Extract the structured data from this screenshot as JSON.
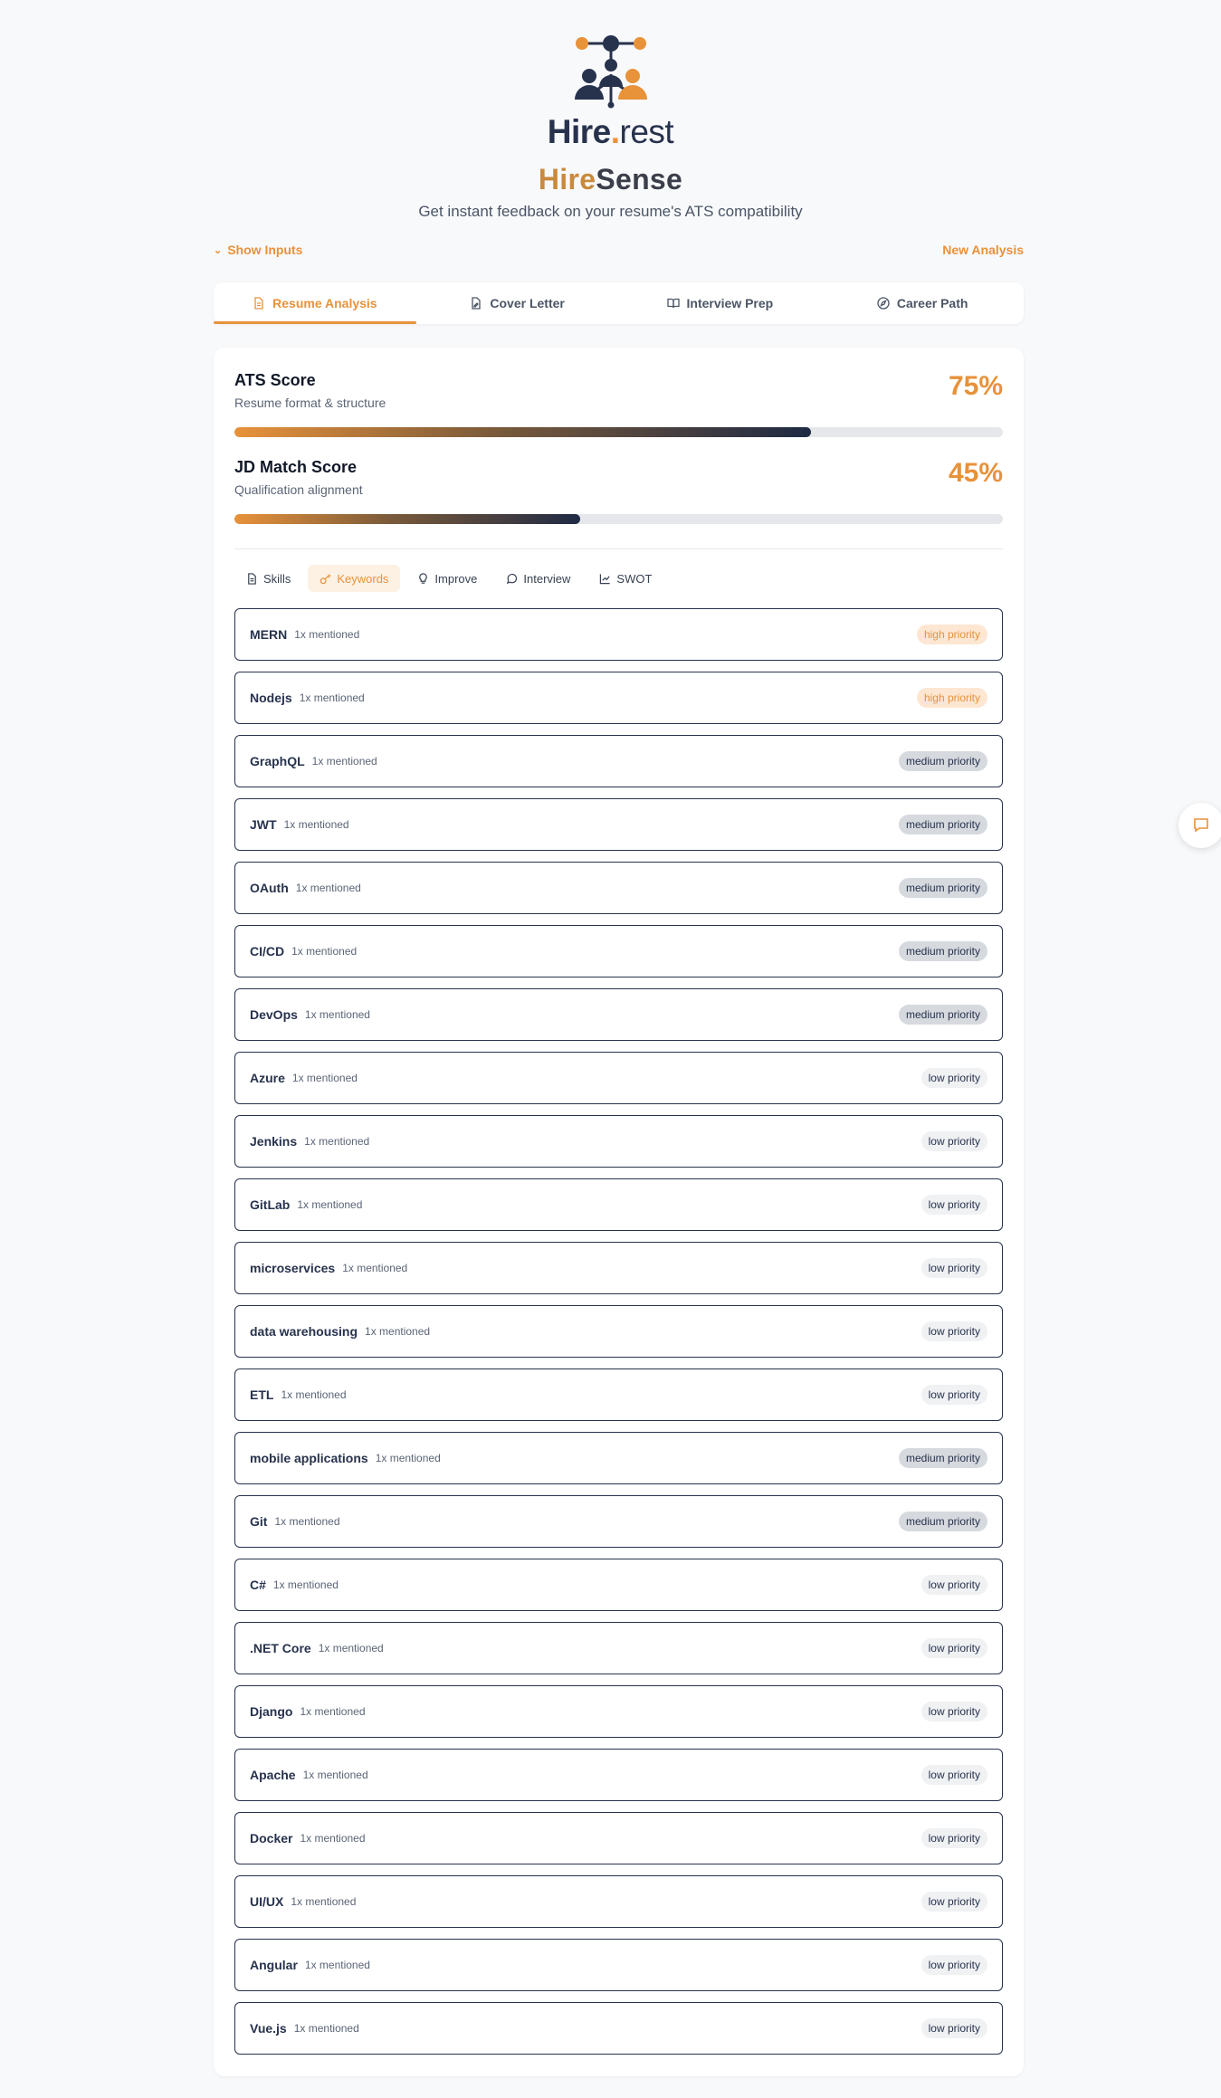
{
  "brand": {
    "logo_name": "Hire",
    "logo_dot": ".",
    "logo_suffix": "rest",
    "app_title_part1": "Hire",
    "app_title_part2": "Sense",
    "subtitle": "Get instant feedback on your resume's ATS compatibility",
    "accent": "#e8923a",
    "navy": "#27324d"
  },
  "toolbar": {
    "show_inputs": "Show Inputs",
    "new_analysis": "New Analysis"
  },
  "tabs": [
    {
      "label": "Resume Analysis",
      "icon": "file-text-icon",
      "active": true
    },
    {
      "label": "Cover Letter",
      "icon": "file-edit-icon",
      "active": false
    },
    {
      "label": "Interview Prep",
      "icon": "book-open-icon",
      "active": false
    },
    {
      "label": "Career Path",
      "icon": "compass-icon",
      "active": false
    }
  ],
  "scores": {
    "ats": {
      "title": "ATS Score",
      "subtitle": "Resume format & structure",
      "value_label": "75%",
      "value": 75
    },
    "jd": {
      "title": "JD Match Score",
      "subtitle": "Qualification alignment",
      "value_label": "45%",
      "value": 45
    }
  },
  "subtabs": [
    {
      "label": "Skills",
      "icon": "file-icon",
      "active": false
    },
    {
      "label": "Keywords",
      "icon": "key-icon",
      "active": true
    },
    {
      "label": "Improve",
      "icon": "lightbulb-icon",
      "active": false
    },
    {
      "label": "Interview",
      "icon": "message-circle-icon",
      "active": false
    },
    {
      "label": "SWOT",
      "icon": "line-chart-icon",
      "active": false
    }
  ],
  "keywords": [
    {
      "name": "MERN",
      "count": "1x mentioned",
      "priority": "high priority",
      "level": "high"
    },
    {
      "name": "Nodejs",
      "count": "1x mentioned",
      "priority": "high priority",
      "level": "high"
    },
    {
      "name": "GraphQL",
      "count": "1x mentioned",
      "priority": "medium priority",
      "level": "medium"
    },
    {
      "name": "JWT",
      "count": "1x mentioned",
      "priority": "medium priority",
      "level": "medium"
    },
    {
      "name": "OAuth",
      "count": "1x mentioned",
      "priority": "medium priority",
      "level": "medium"
    },
    {
      "name": "CI/CD",
      "count": "1x mentioned",
      "priority": "medium priority",
      "level": "medium"
    },
    {
      "name": "DevOps",
      "count": "1x mentioned",
      "priority": "medium priority",
      "level": "medium"
    },
    {
      "name": "Azure",
      "count": "1x mentioned",
      "priority": "low priority",
      "level": "low"
    },
    {
      "name": "Jenkins",
      "count": "1x mentioned",
      "priority": "low priority",
      "level": "low"
    },
    {
      "name": "GitLab",
      "count": "1x mentioned",
      "priority": "low priority",
      "level": "low"
    },
    {
      "name": "microservices",
      "count": "1x mentioned",
      "priority": "low priority",
      "level": "low"
    },
    {
      "name": "data warehousing",
      "count": "1x mentioned",
      "priority": "low priority",
      "level": "low"
    },
    {
      "name": "ETL",
      "count": "1x mentioned",
      "priority": "low priority",
      "level": "low"
    },
    {
      "name": "mobile applications",
      "count": "1x mentioned",
      "priority": "medium priority",
      "level": "medium"
    },
    {
      "name": "Git",
      "count": "1x mentioned",
      "priority": "medium priority",
      "level": "medium"
    },
    {
      "name": "C#",
      "count": "1x mentioned",
      "priority": "low priority",
      "level": "low"
    },
    {
      "name": ".NET Core",
      "count": "1x mentioned",
      "priority": "low priority",
      "level": "low"
    },
    {
      "name": "Django",
      "count": "1x mentioned",
      "priority": "low priority",
      "level": "low"
    },
    {
      "name": "Apache",
      "count": "1x mentioned",
      "priority": "low priority",
      "level": "low"
    },
    {
      "name": "Docker",
      "count": "1x mentioned",
      "priority": "low priority",
      "level": "low"
    },
    {
      "name": "UI/UX",
      "count": "1x mentioned",
      "priority": "low priority",
      "level": "low"
    },
    {
      "name": "Angular",
      "count": "1x mentioned",
      "priority": "low priority",
      "level": "low"
    },
    {
      "name": "Vue.js",
      "count": "1x mentioned",
      "priority": "low priority",
      "level": "low"
    }
  ],
  "chat_fab": {
    "icon": "chat-icon"
  }
}
